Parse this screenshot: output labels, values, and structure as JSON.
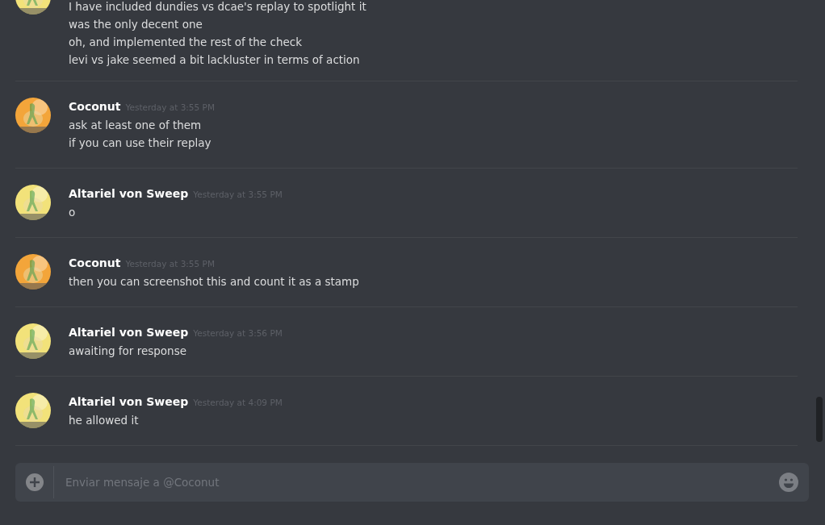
{
  "messages": [
    {
      "color": "#f2e27a",
      "lines": [
        "I have included dundies vs dcae's replay to spotlight it",
        "was the only decent one",
        "oh, and implemented the rest of the check",
        "levi vs jake seemed a bit lackluster in terms of action"
      ]
    },
    {
      "author": "Coconut",
      "timestamp": "Yesterday at 3:55 PM",
      "color": "#f3a53a",
      "lines": [
        "ask at least one of them",
        "if you can use their replay"
      ]
    },
    {
      "author": "Altariel von Sweep",
      "timestamp": "Yesterday at 3:55 PM",
      "color": "#f2e27a",
      "lines": [
        "o"
      ]
    },
    {
      "author": "Coconut",
      "timestamp": "Yesterday at 3:55 PM",
      "color": "#f3a53a",
      "lines": [
        "then you can screenshot this and count it as a stamp"
      ]
    },
    {
      "author": "Altariel von Sweep",
      "timestamp": "Yesterday at 3:56 PM",
      "color": "#f2e27a",
      "lines": [
        "awaiting for response"
      ]
    },
    {
      "author": "Altariel von Sweep",
      "timestamp": "Yesterday at 4:09 PM",
      "color": "#f2e27a",
      "lines": [
        "he allowed it"
      ]
    }
  ],
  "composer": {
    "placeholder": "Enviar mensaje a @Coconut"
  }
}
